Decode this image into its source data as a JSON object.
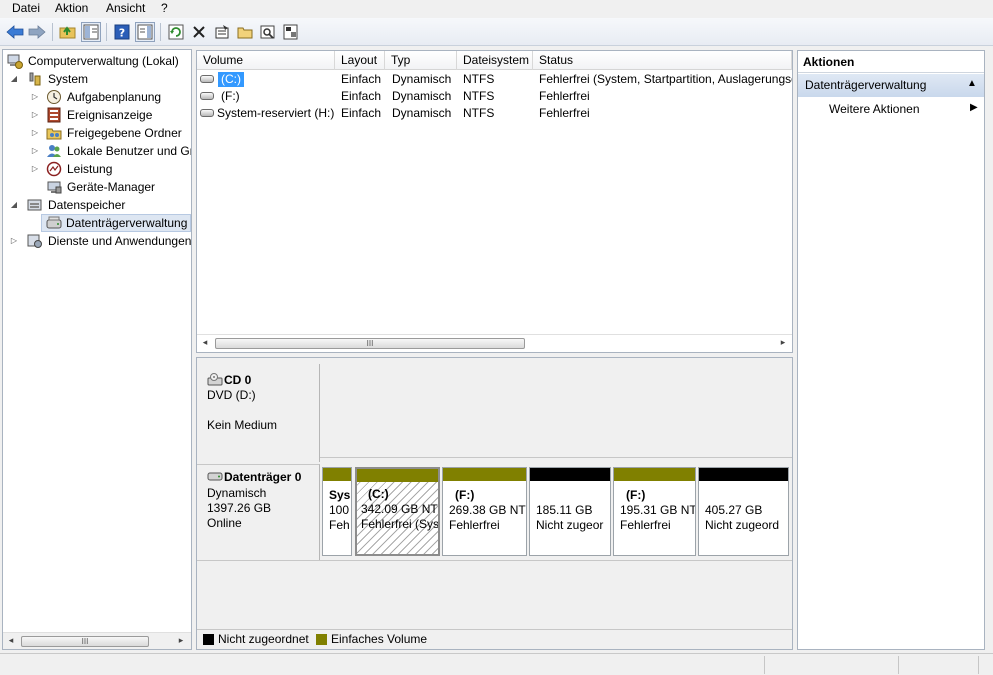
{
  "menu": {
    "items": [
      "Datei",
      "Aktion",
      "Ansicht",
      "?"
    ]
  },
  "toolbar": {
    "icons": [
      "back-icon",
      "forward-icon",
      "up-folder-icon",
      "show-tree-icon",
      "help-icon",
      "show-action-pane-icon",
      "refresh-icon",
      "delete-icon",
      "properties-icon",
      "open-icon",
      "find-icon",
      "export-icon"
    ]
  },
  "tree": {
    "root": "Computerverwaltung (Lokal)",
    "system": "System",
    "aufgaben": "Aufgabenplanung",
    "ereignis": "Ereignisanzeige",
    "freigegeben": "Freigegebene Ordner",
    "lokale": "Lokale Benutzer und Gru",
    "leistung": "Leistung",
    "geraete": "Geräte-Manager",
    "datenspeicher": "Datenspeicher",
    "datentraeger": "Datenträgerverwaltung",
    "dienste": "Dienste und Anwendungen",
    "scroll_thumb": "III"
  },
  "list": {
    "columns": [
      "Volume",
      "Layout",
      "Typ",
      "Dateisystem",
      "Status"
    ],
    "rows": [
      {
        "volume": "(C:)",
        "layout": "Einfach",
        "typ": "Dynamisch",
        "fs": "NTFS",
        "status": "Fehlerfrei (System, Startpartition, Auslagerungsd"
      },
      {
        "volume": "(F:)",
        "layout": "Einfach",
        "typ": "Dynamisch",
        "fs": "NTFS",
        "status": "Fehlerfrei"
      },
      {
        "volume": "System-reserviert (H:)",
        "layout": "Einfach",
        "typ": "Dynamisch",
        "fs": "NTFS",
        "status": "Fehlerfrei"
      }
    ],
    "scroll_thumb": "III"
  },
  "disks": {
    "cd0": {
      "name": "CD 0",
      "line1": "DVD (D:)",
      "line2": "Kein Medium"
    },
    "disk0": {
      "name": "Datenträger 0",
      "type": "Dynamisch",
      "size": "1397.26 GB",
      "state": "Online"
    },
    "partitions": [
      {
        "title": "Sys",
        "size": "100",
        "status": "Feh"
      },
      {
        "title": "(C:)",
        "size": "342.09 GB NTI",
        "status": "Fehlerfrei (Sys"
      },
      {
        "title": "(F:)",
        "size": "269.38 GB NT",
        "status": "Fehlerfrei"
      },
      {
        "title": "",
        "size": "185.11 GB",
        "status": "Nicht zugeor"
      },
      {
        "title": "(F:)",
        "size": "195.31 GB NT",
        "status": "Fehlerfrei"
      },
      {
        "title": "",
        "size": "405.27 GB",
        "status": "Nicht zugeord"
      }
    ]
  },
  "legend": {
    "unallocated": "Nicht zugeordnet",
    "simple": "Einfaches Volume"
  },
  "colors": {
    "unallocated": "#000000",
    "simple": "#808000",
    "selection": "#dde6f2"
  },
  "actions": {
    "header": "Aktionen",
    "section": "Datenträgerverwaltung",
    "more": "Weitere Aktionen"
  }
}
